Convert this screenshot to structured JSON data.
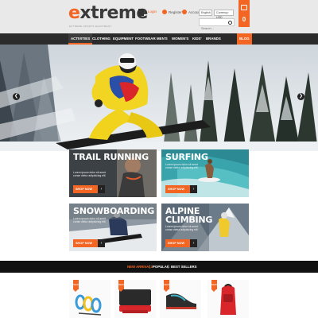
{
  "brand": {
    "logo_first": "e",
    "logo_rest": "xtreme",
    "tagline": "EXTREME SPORTS EQUIPMENT"
  },
  "header": {
    "login": "Login",
    "register": "Register",
    "account": "Account",
    "language": "English",
    "currency": "Currency: USD",
    "search_placeholder": "Search...",
    "cart_count": "0"
  },
  "nav": {
    "items": [
      "Activities",
      "Clothing",
      "Equipment",
      "Footwear",
      "Men's",
      "Women's",
      "Kids'",
      "Brands"
    ],
    "blog": "Blog"
  },
  "promos": [
    {
      "title": "Trail Running",
      "text": "Lorem ipsum dolor sit amet conse ctetur adipisicing elit",
      "button": "Shop now"
    },
    {
      "title": "Surfing",
      "text": "Lorem ipsum dolor sit amet conse ctetur adipisicing elit",
      "button": "Shop now"
    },
    {
      "title": "Snowboarding",
      "text": "Lorem ipsum dolor sit amet conse ctetur adipisicing elit",
      "button": "Shop now"
    },
    {
      "title": "Alpine Climbing",
      "text": "Lorem ipsum dolor sit amet conse ctetur adipisicing elit",
      "button": "Shop now"
    }
  ],
  "tabs": [
    "New Arrivals",
    "Popular",
    "Best Sellers"
  ],
  "products": [
    {
      "badge": "NEW",
      "icon": "carabiner-set-icon"
    },
    {
      "badge": "NEW",
      "icon": "sleeping-pad-icon"
    },
    {
      "badge": "NEW",
      "icon": "climbing-shoe-icon"
    },
    {
      "badge": "NEW",
      "icon": "backpack-icon"
    }
  ],
  "colors": {
    "accent": "#f26522",
    "nav_bg": "#2b2b2b",
    "header_bg": "#e9e9e9",
    "tabs_bg": "#111111"
  }
}
